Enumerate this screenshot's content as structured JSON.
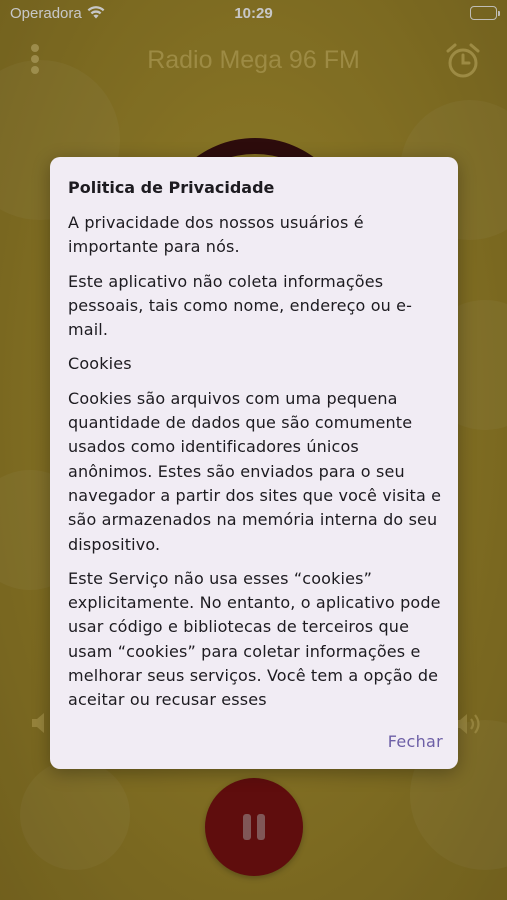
{
  "status_bar": {
    "carrier": "Operadora",
    "time": "10:29"
  },
  "app": {
    "title": "Radio Mega 96 FM"
  },
  "dialog": {
    "title": "Politica de Privacidade",
    "paragraphs": [
      "A privacidade dos nossos usuários é importante para nós.",
      "Este aplicativo não coleta informações pessoais, tais como nome, endereço ou e-mail.",
      "Cookies",
      "Cookies são arquivos com uma pequena quantidade de dados que são comumente usados como identificadores únicos anônimos. Estes são enviados para o seu navegador a partir dos sites que você visita e são armazenados na memória interna do seu dispositivo.",
      "Este Serviço não usa esses “cookies” explicitamente. No entanto, o aplicativo pode usar código e bibliotecas de terceiros que usam “cookies” para coletar informações e melhorar seus serviços. Você tem a opção de aceitar ou recusar esses"
    ],
    "close_label": "Fechar"
  },
  "colors": {
    "background": "#a8902e",
    "pause_button": "#7a1111",
    "dialog_bg": "#f1ecf4",
    "accent": "#6d5fa6"
  },
  "icons": [
    "wifi-icon",
    "battery-icon",
    "menu-dots-icon",
    "alarm-clock-icon",
    "volume-low-icon",
    "volume-high-icon",
    "pause-icon"
  ]
}
